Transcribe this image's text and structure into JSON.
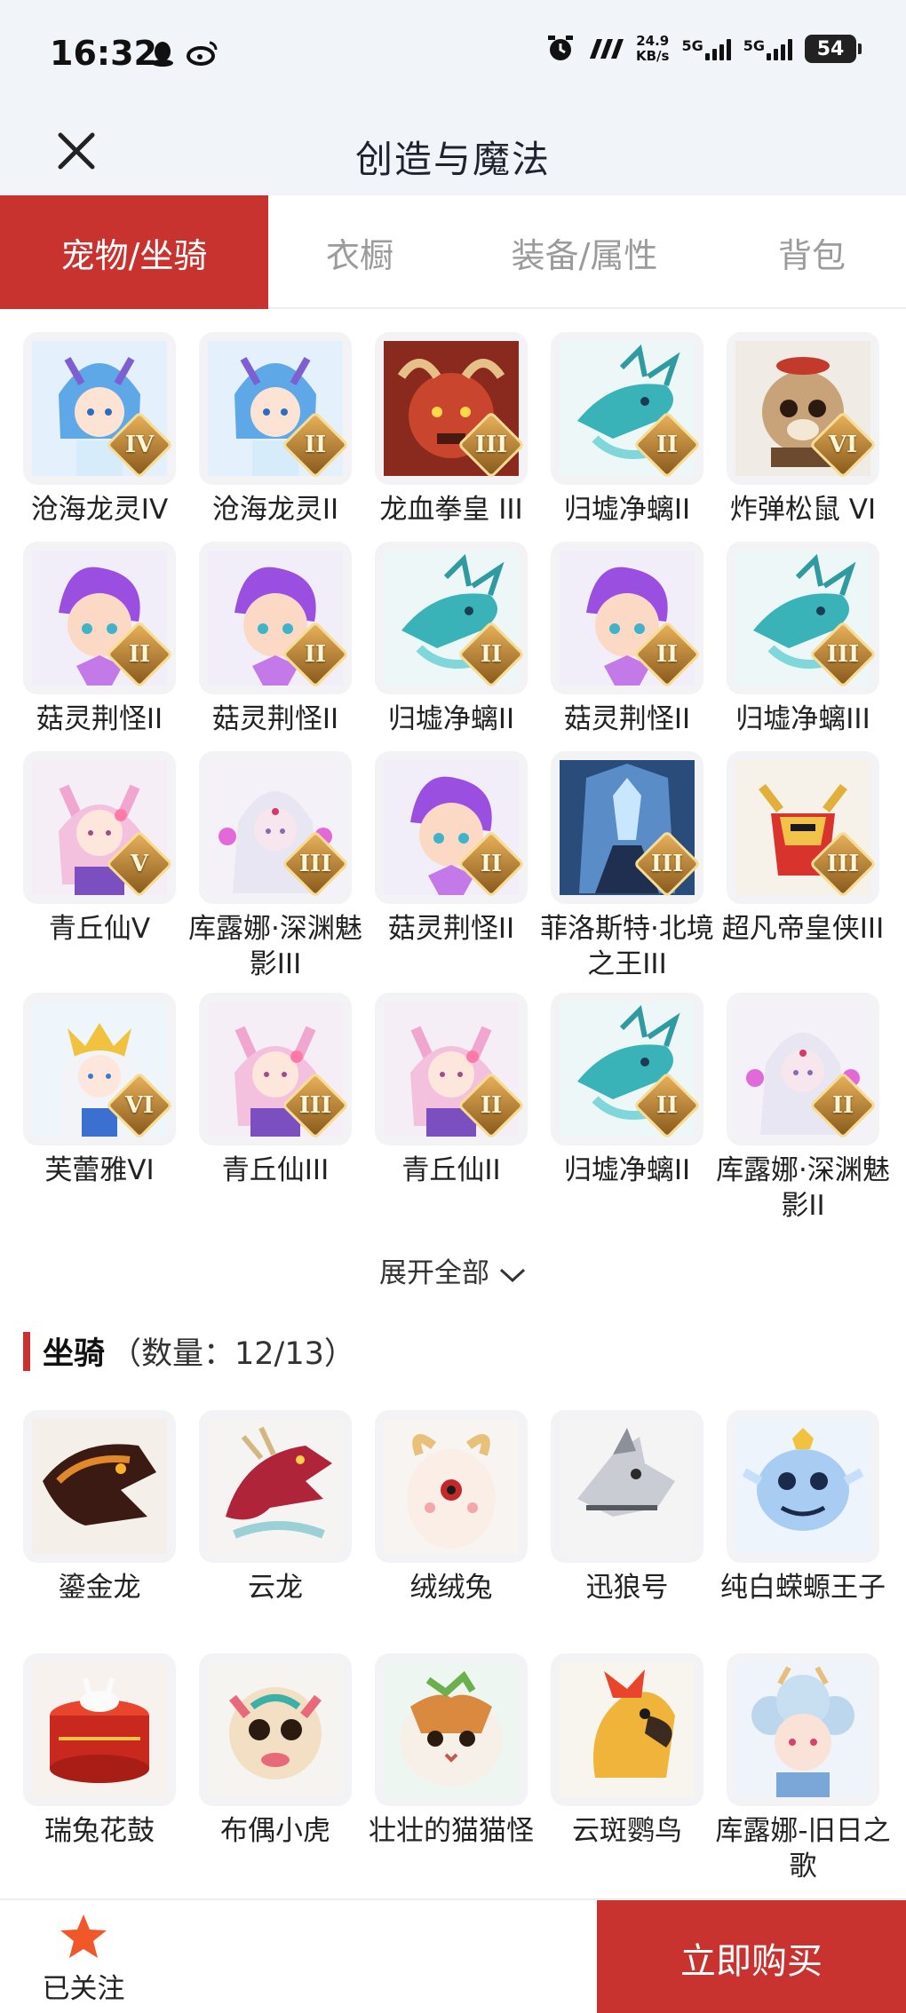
{
  "status_bar": {
    "time": "16:32",
    "net_speed_value": "24.9",
    "net_speed_unit": "KB/s",
    "signal1": "5G",
    "signal2": "5G",
    "battery": "54"
  },
  "header": {
    "title": "创造与魔法"
  },
  "tabs": [
    {
      "label": "宠物/坐骑",
      "active": true
    },
    {
      "label": "衣橱",
      "active": false
    },
    {
      "label": "装备/属性",
      "active": false
    },
    {
      "label": "背包",
      "active": false
    }
  ],
  "pets": [
    {
      "name": "沧海龙灵IV",
      "badge": "IV",
      "art": "blue-hair-icon"
    },
    {
      "name": "沧海龙灵II",
      "badge": "II",
      "art": "blue-hair-icon"
    },
    {
      "name": "龙血拳皇 III",
      "badge": "III",
      "art": "red-beast-icon"
    },
    {
      "name": "归墟净螭II",
      "badge": "II",
      "art": "teal-dragon-icon"
    },
    {
      "name": "炸弹松鼠 VI",
      "badge": "VI",
      "art": "squirrel-icon"
    },
    {
      "name": "菇灵荆怪II",
      "badge": "II",
      "art": "purple-sprite-icon"
    },
    {
      "name": "菇灵荆怪II",
      "badge": "II",
      "art": "purple-sprite-icon"
    },
    {
      "name": "归墟净螭II",
      "badge": "II",
      "art": "teal-dragon-icon"
    },
    {
      "name": "菇灵荆怪II",
      "badge": "II",
      "art": "purple-sprite-icon"
    },
    {
      "name": "归墟净螭III",
      "badge": "III",
      "art": "teal-dragon-icon"
    },
    {
      "name": "青丘仙V",
      "badge": "V",
      "art": "pink-fox-girl-icon"
    },
    {
      "name": "库露娜·深渊魅影III",
      "badge": "III",
      "art": "white-spirit-icon"
    },
    {
      "name": "菇灵荆怪II",
      "badge": "II",
      "art": "purple-sprite-icon"
    },
    {
      "name": "菲洛斯特·北境之王III",
      "badge": "III",
      "art": "ice-king-icon"
    },
    {
      "name": "超凡帝皇侠III",
      "badge": "III",
      "art": "gold-armor-icon"
    },
    {
      "name": "芙蕾雅VI",
      "badge": "VI",
      "art": "golden-crown-girl-icon"
    },
    {
      "name": "青丘仙III",
      "badge": "III",
      "art": "pink-fox-girl-icon"
    },
    {
      "name": "青丘仙II",
      "badge": "II",
      "art": "pink-fox-girl-icon"
    },
    {
      "name": "归墟净螭II",
      "badge": "II",
      "art": "teal-dragon-icon"
    },
    {
      "name": "库露娜·深渊魅影II",
      "badge": "II",
      "art": "white-spirit-icon"
    }
  ],
  "expand_label": "展开全部",
  "mounts_section": {
    "title": "坐骑",
    "count_label": "（数量：12/13）"
  },
  "mounts": [
    {
      "name": "鎏金龙",
      "art": "golden-dragon-icon"
    },
    {
      "name": "云龙",
      "art": "cloud-dragon-icon"
    },
    {
      "name": "绒绒兔",
      "art": "fluffy-rabbit-icon"
    },
    {
      "name": "迅狼号",
      "art": "mech-wolf-icon"
    },
    {
      "name": "纯白蝾螈王子",
      "art": "white-salamander-icon"
    },
    {
      "name": "瑞兔花鼓",
      "art": "rabbit-drum-icon"
    },
    {
      "name": "布偶小虎",
      "art": "doll-tiger-icon"
    },
    {
      "name": "壮壮的猫猫怪",
      "art": "chubby-cat-icon"
    },
    {
      "name": "云斑鹦鸟",
      "art": "parrot-icon"
    },
    {
      "name": "库露娜-旧日之歌",
      "art": "curly-girl-icon"
    }
  ],
  "bottom": {
    "follow_label": "已关注",
    "buy_label": "立即购买"
  },
  "colors": {
    "accent": "#c8322f",
    "header_bg": "#f1f4f8",
    "star": "#f0582a"
  }
}
